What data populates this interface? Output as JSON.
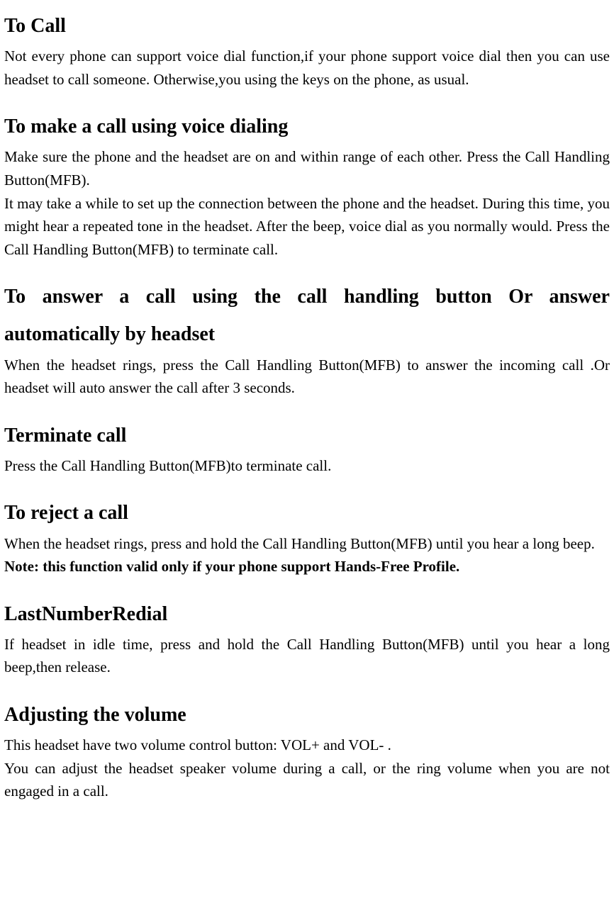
{
  "sections": [
    {
      "heading": "To Call",
      "paragraphs": [
        "Not every phone can support voice dial function,if your phone support voice dial then you can use headset to call someone. Otherwise,you using the keys on the phone, as usual."
      ]
    },
    {
      "heading": "To make a call using voice dialing",
      "paragraphs": [
        "Make sure the phone and the headset are on and within range of each other. Press the Call Handling Button(MFB).",
        "It may take a while to set up the connection between the phone and the headset. During this time, you might hear a repeated tone in the headset. After the beep, voice dial as you normally would. Press the Call Handling Button(MFB) to terminate call."
      ]
    },
    {
      "heading_line1": "To answer a call using the call handling button Or answer",
      "heading_line2": "automatically by headset",
      "paragraphs": [
        "When the headset rings, press the Call Handling Button(MFB) to answer the incoming call .Or headset will auto answer the call after 3 seconds."
      ]
    },
    {
      "heading": "Terminate call",
      "paragraphs": [
        "Press the Call Handling Button(MFB)to terminate call."
      ]
    },
    {
      "heading": "To reject a call",
      "paragraphs": [
        "When the headset rings, press and hold the Call Handling Button(MFB) until you hear a long beep."
      ],
      "note": "Note: this function valid only if your phone support Hands-Free Profile."
    },
    {
      "heading": "LastNumberRedial",
      "paragraphs": [
        "If headset in idle time, press and hold the Call Handling Button(MFB) until you hear a long beep,then release."
      ]
    },
    {
      "heading": "Adjusting the volume",
      "paragraphs": [
        "This headset have two volume control button: VOL+ and VOL- .",
        "You can adjust the headset speaker volume during a call, or the ring volume when you are not engaged in a call."
      ]
    }
  ]
}
